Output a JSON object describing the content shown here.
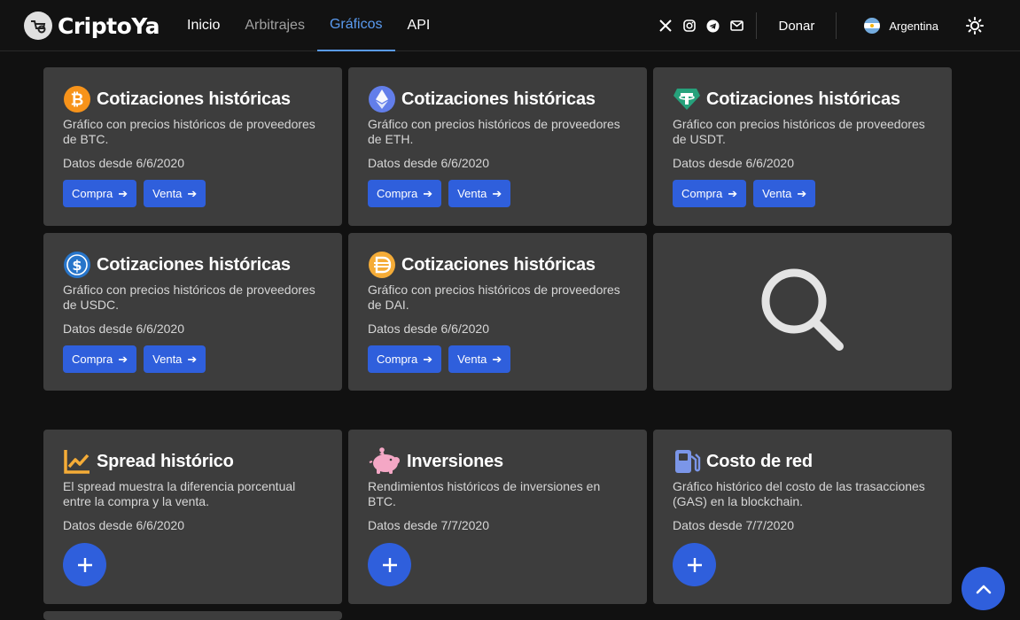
{
  "brand": {
    "name": "CriptoYa",
    "logo": "caddy-logo-icon"
  },
  "nav": {
    "links": [
      {
        "label": "Inicio",
        "state": "normal"
      },
      {
        "label": "Arbitrajes",
        "state": "muted"
      },
      {
        "label": "Gráficos",
        "state": "active"
      },
      {
        "label": "API",
        "state": "normal"
      }
    ],
    "social": [
      "x-icon",
      "instagram-icon",
      "telegram-icon",
      "mail-icon"
    ],
    "donate_label": "Donar",
    "country_label": "Argentina",
    "theme_icon": "sun-icon"
  },
  "cards_coins": [
    {
      "coin": "BTC",
      "icon": "bitcoin-icon",
      "color": "#f7931a",
      "title": "Cotizaciones históricas",
      "desc": "Gráfico con precios históricos de proveedores de BTC.",
      "since": "Datos desde 6/6/2020",
      "buy_label": "Compra",
      "sell_label": "Venta"
    },
    {
      "coin": "ETH",
      "icon": "ethereum-icon",
      "color": "#627eea",
      "title": "Cotizaciones históricas",
      "desc": "Gráfico con precios históricos de proveedores de ETH.",
      "since": "Datos desde 6/6/2020",
      "buy_label": "Compra",
      "sell_label": "Venta"
    },
    {
      "coin": "USDT",
      "icon": "tether-icon",
      "color": "#26a17b",
      "title": "Cotizaciones históricas",
      "desc": "Gráfico con precios históricos de proveedores de USDT.",
      "since": "Datos desde 6/6/2020",
      "buy_label": "Compra",
      "sell_label": "Venta"
    },
    {
      "coin": "USDC",
      "icon": "usdc-icon",
      "color": "#2775ca",
      "title": "Cotizaciones históricas",
      "desc": "Gráfico con precios históricos de proveedores de USDC.",
      "since": "Datos desde 6/6/2020",
      "buy_label": "Compra",
      "sell_label": "Venta"
    },
    {
      "coin": "DAI",
      "icon": "dai-icon",
      "color": "#f5ac37",
      "title": "Cotizaciones históricas",
      "desc": "Gráfico con precios históricos de proveedores de DAI.",
      "since": "Datos desde 6/6/2020",
      "buy_label": "Compra",
      "sell_label": "Venta"
    }
  ],
  "search_card": {
    "icon": "search-icon"
  },
  "cards_tools": [
    {
      "icon": "chart-line-icon",
      "color": "#f5ac37",
      "title": "Spread histórico",
      "desc": "El spread muestra la diferencia porcentual entre la compra y la venta.",
      "since": "Datos desde 6/6/2020"
    },
    {
      "icon": "piggy-bank-icon",
      "color": "#f4a7c5",
      "title": "Inversiones",
      "desc": "Rendimientos históricos de inversiones en BTC.",
      "since": "Datos desde 7/7/2020"
    },
    {
      "icon": "gas-pump-icon",
      "color": "#7b96e8",
      "title": "Costo de red",
      "desc": "Gráfico histórico del costo de las trasacciones (GAS) en la blockchain.",
      "since": "Datos desde 7/7/2020"
    }
  ],
  "colors": {
    "accent": "#2f5fdc",
    "active_link": "#5a9bf0",
    "card_bg": "#3d3d3d",
    "page_bg": "#111111"
  }
}
